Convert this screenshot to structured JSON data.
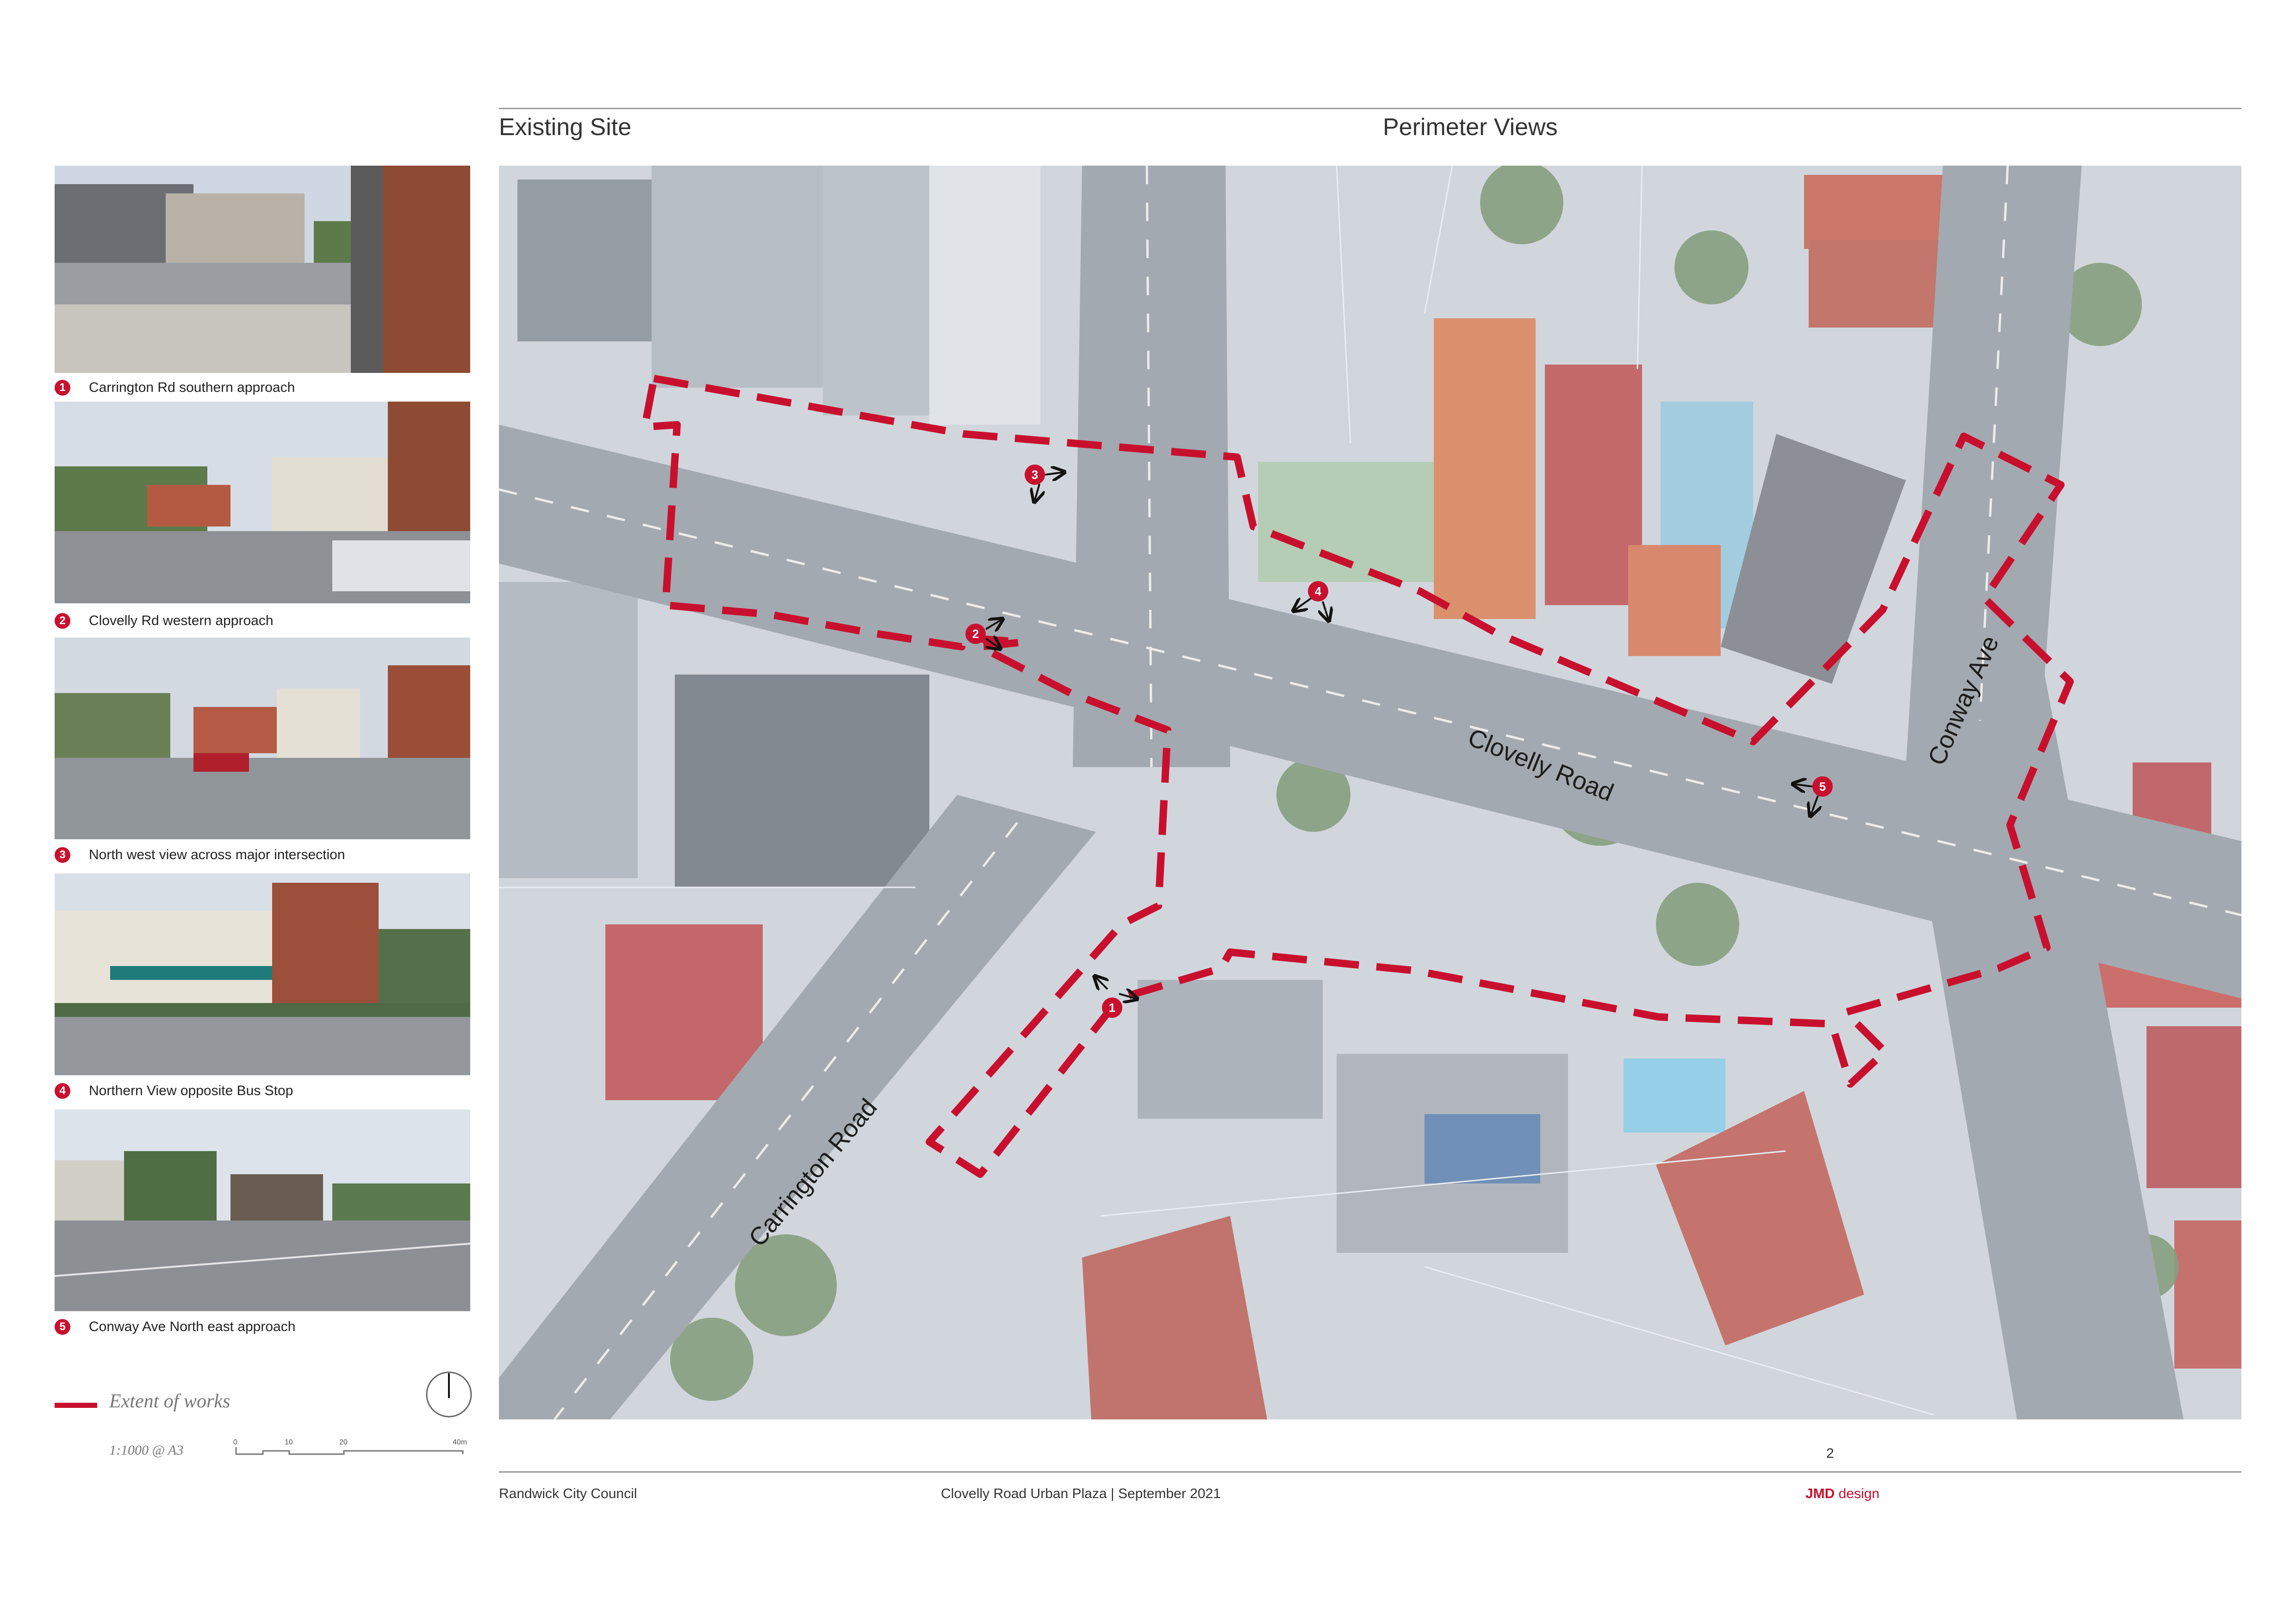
{
  "header": {
    "left_title": "Existing Site",
    "center_title": "Perimeter Views"
  },
  "photos": [
    {
      "number": "1",
      "caption": "Carrington Rd southern approach"
    },
    {
      "number": "2",
      "caption": "Clovelly Rd western approach"
    },
    {
      "number": "3",
      "caption": "North west view across major intersection"
    },
    {
      "number": "4",
      "caption": "Northern View opposite Bus Stop"
    },
    {
      "number": "5",
      "caption": "Conway Ave North east approach"
    }
  ],
  "map": {
    "street_labels": {
      "clovelly": "Clovelly Road",
      "conway": "Conway Ave",
      "carrington": "Carrington Road"
    },
    "viewpoints": [
      "1",
      "2",
      "3",
      "4",
      "5"
    ]
  },
  "legend": {
    "extent_label": "Extent of works",
    "scale_label": "1:1000 @ A3",
    "scale_ticks": [
      "0",
      "10",
      "20",
      "40m"
    ]
  },
  "footer": {
    "page_number": "2",
    "client": "Randwick City Council",
    "project": "Clovelly Road Urban Plaza | September 2021",
    "brand_bold": "JMD",
    "brand_rest": " design"
  },
  "colors": {
    "accent": "#c8102e",
    "map_base": "#c7ced6",
    "road": "#8f979f"
  }
}
